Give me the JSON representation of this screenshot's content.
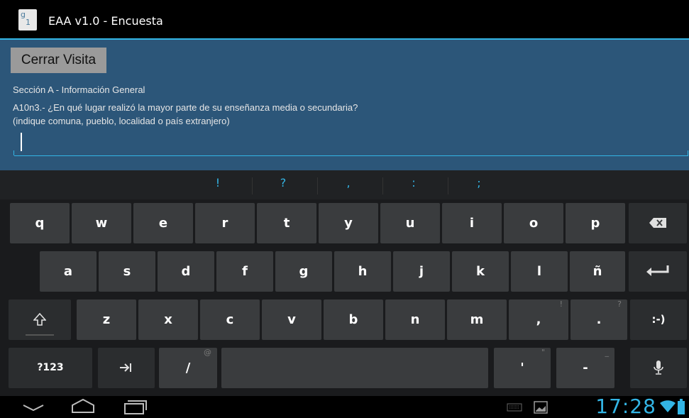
{
  "titlebar": {
    "title": "EAA v1.0 - Encuesta"
  },
  "form": {
    "close_button": "Cerrar Visita",
    "section": "Sección A - Información General",
    "question_line1": "A10n3.- ¿En qué lugar realizó la mayor parte de su enseñanza media o secundaria?",
    "question_line2": "(indique comuna, pueblo, localidad o país extranjero)",
    "answer_value": ""
  },
  "keyboard": {
    "suggestions": [
      "!",
      "?",
      ",",
      ":",
      ";"
    ],
    "row1": [
      "q",
      "w",
      "e",
      "r",
      "t",
      "y",
      "u",
      "i",
      "o",
      "p"
    ],
    "row2": [
      "a",
      "s",
      "d",
      "f",
      "g",
      "h",
      "j",
      "k",
      "l",
      "ñ"
    ],
    "row3": [
      "z",
      "x",
      "c",
      "v",
      "b",
      "n",
      "m",
      ",",
      "."
    ],
    "row3_subs": {
      "comma": "!",
      "period": "?"
    },
    "smiley": ":-)",
    "mode_key": "?123",
    "slash": "/",
    "slash_sub": "@",
    "apostrophe": "'",
    "apostrophe_sub": "\"",
    "dash": "-",
    "dash_sub": "_"
  },
  "statusbar": {
    "clock": "17:28"
  },
  "colors": {
    "accent": "#33b5e5",
    "content_bg": "#2c5679"
  }
}
